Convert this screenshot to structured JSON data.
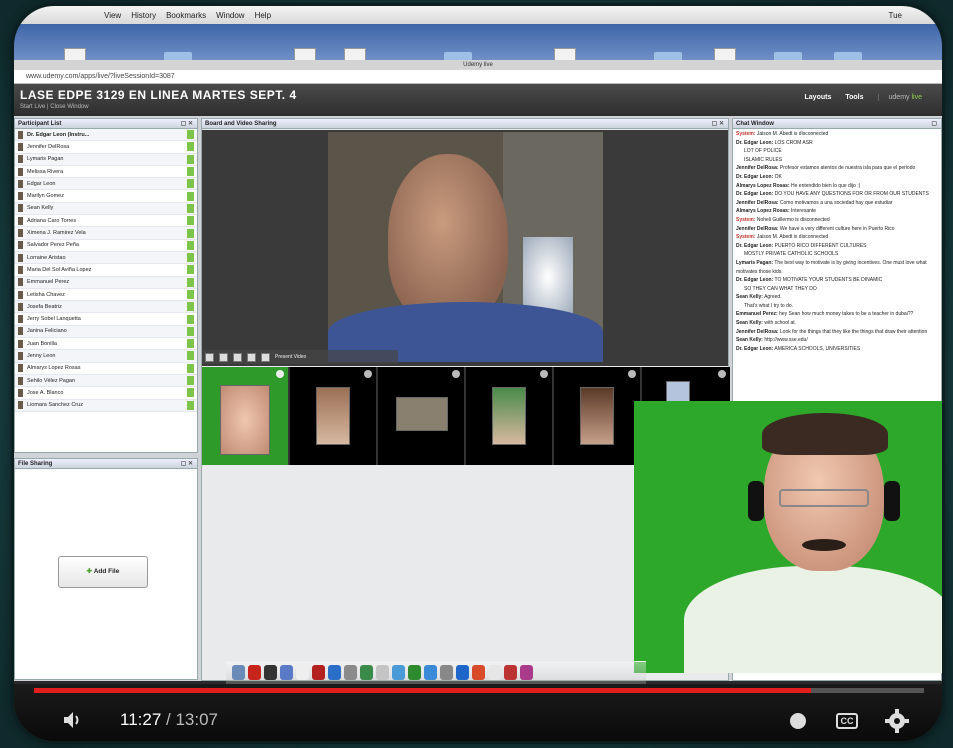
{
  "menubar": {
    "items": [
      "View",
      "History",
      "Bookmarks",
      "Window",
      "Help"
    ],
    "right_status": "Tue"
  },
  "window_title": "Udemy live",
  "url": "www.udemy.com/apps/live/?liveSessionId=3087",
  "app": {
    "title": "LASE EDPE 3129 EN LINEA MARTES SEPT. 4",
    "subtitle": "Start Live  |  Close Window",
    "nav": {
      "layouts": "Layouts",
      "tools": "Tools",
      "brand_prefix": "udemy",
      "brand_suffix": "live"
    }
  },
  "panels": {
    "participants_title": "Participant List",
    "board_title": "Board and Video Sharing",
    "chat_title": "Chat Window",
    "file_title": "File Sharing"
  },
  "participants": [
    "Dr. Edgar Leon (Instru...",
    "Jennifer DelRosa",
    "Lymaris Pagan",
    "Melissa Rivera",
    "Edgar Leon",
    "Marilyn Gomez",
    "Sean Kelly",
    "Adriana Caro Torres",
    "Ximena J. Ramirez Vela",
    "Salvador Perez Peña",
    "Lorraine Aristao",
    "Maria Del Sol Aviña Lopez",
    "Emmanuel Perez",
    "Letisha Chavez",
    "Josefa Beatriz",
    "Jerry Sobel Lanquetta",
    "Janina Feliciano",
    "Juan Bonilla",
    "Jenny Leon",
    "Almarys Lopez Rosas",
    "Sehilo Vélez Pagan",
    "Jose A. Blanco",
    "Liomara Sanchez Cruz"
  ],
  "video_controls": {
    "label": "Present Video"
  },
  "thumbnails_count_label": "",
  "chat_lines": [
    {
      "name": "System:",
      "text": "Jaison M. Abedt is disconnected",
      "sys": true
    },
    {
      "name": "Dr. Edgar Leon:",
      "text": "LOS CROM ASR"
    },
    {
      "name": "",
      "text": "LOT OF POLICE"
    },
    {
      "name": "",
      "text": "ISLAMIC RULES"
    },
    {
      "name": "Jennifer DelRosa:",
      "text": "Profesor estamos atentos de nuestra isla para que el periodo"
    },
    {
      "name": "Dr. Edgar Leon:",
      "text": "OK"
    },
    {
      "name": "Almarys Lopez Rosas:",
      "text": "He entendido bien lo que dijo :)"
    },
    {
      "name": "Dr. Edgar Leon:",
      "text": "DO YOU HAVE ANY QUESTIONS FOR OR FROM OUR STUDENTS"
    },
    {
      "name": "Jennifer DelRosa:",
      "text": "Como motivamos a una sociedad hay que estudiar"
    },
    {
      "name": "Almarys Lopez Rosas:",
      "text": "Interesante"
    },
    {
      "name": "System:",
      "text": "Noheli Guillermo is disconnected",
      "sys": true
    },
    {
      "name": "Jennifer DelRosa:",
      "text": "We have a very different culture here in Puerto Rico"
    },
    {
      "name": "System:",
      "text": "Jaison M. Abedt is disconnected",
      "sys": true
    },
    {
      "name": "Dr. Edgar Leon:",
      "text": "PUERTO RICO DIFFERENT CULTURES"
    },
    {
      "name": "",
      "text": "MOSTLY PRIVATE CATHOLIC SCHOOLS"
    },
    {
      "name": "Lymaris Pagan:",
      "text": "The best way to motivate is by giving incentives. One must love what motivates those kids."
    },
    {
      "name": "Dr. Edgar Leon:",
      "text": "TO MOTIVATE YOUR STUDENTS BE DINAMIC"
    },
    {
      "name": "",
      "text": "SO THEY CAN WHAT THEY DO"
    },
    {
      "name": "Sean Kelly:",
      "text": "Agreed."
    },
    {
      "name": "",
      "text": "That's what I try to do."
    },
    {
      "name": "Emmanuel Perez:",
      "text": "hey Sean how much money takes to be a teacher in dubai??"
    },
    {
      "name": "Sean Kelly:",
      "text": "with school at."
    },
    {
      "name": "Jennifer DelRosa:",
      "text": "Look for the things that they like the things that draw their attention"
    },
    {
      "name": "Sean Kelly:",
      "text": "http://www.sse.edu/"
    },
    {
      "name": "Dr. Edgar Leon:",
      "text": "AMERICA SCHOOLS, UNIVERSITIES"
    }
  ],
  "file_sharing": {
    "add_file_label": "Add File"
  },
  "player": {
    "current_time": "11:27",
    "separator": " / ",
    "total_time": "13:07",
    "progress": 0.873,
    "cc_label": "CC",
    "accent": "#e31e1e"
  },
  "colors": {
    "chroma_green": "#2ea82a",
    "participant_check": "#7cc44a"
  },
  "icons": [
    "volume-icon",
    "clock-icon",
    "cc-icon",
    "gear-icon",
    "dock-app-icon"
  ]
}
